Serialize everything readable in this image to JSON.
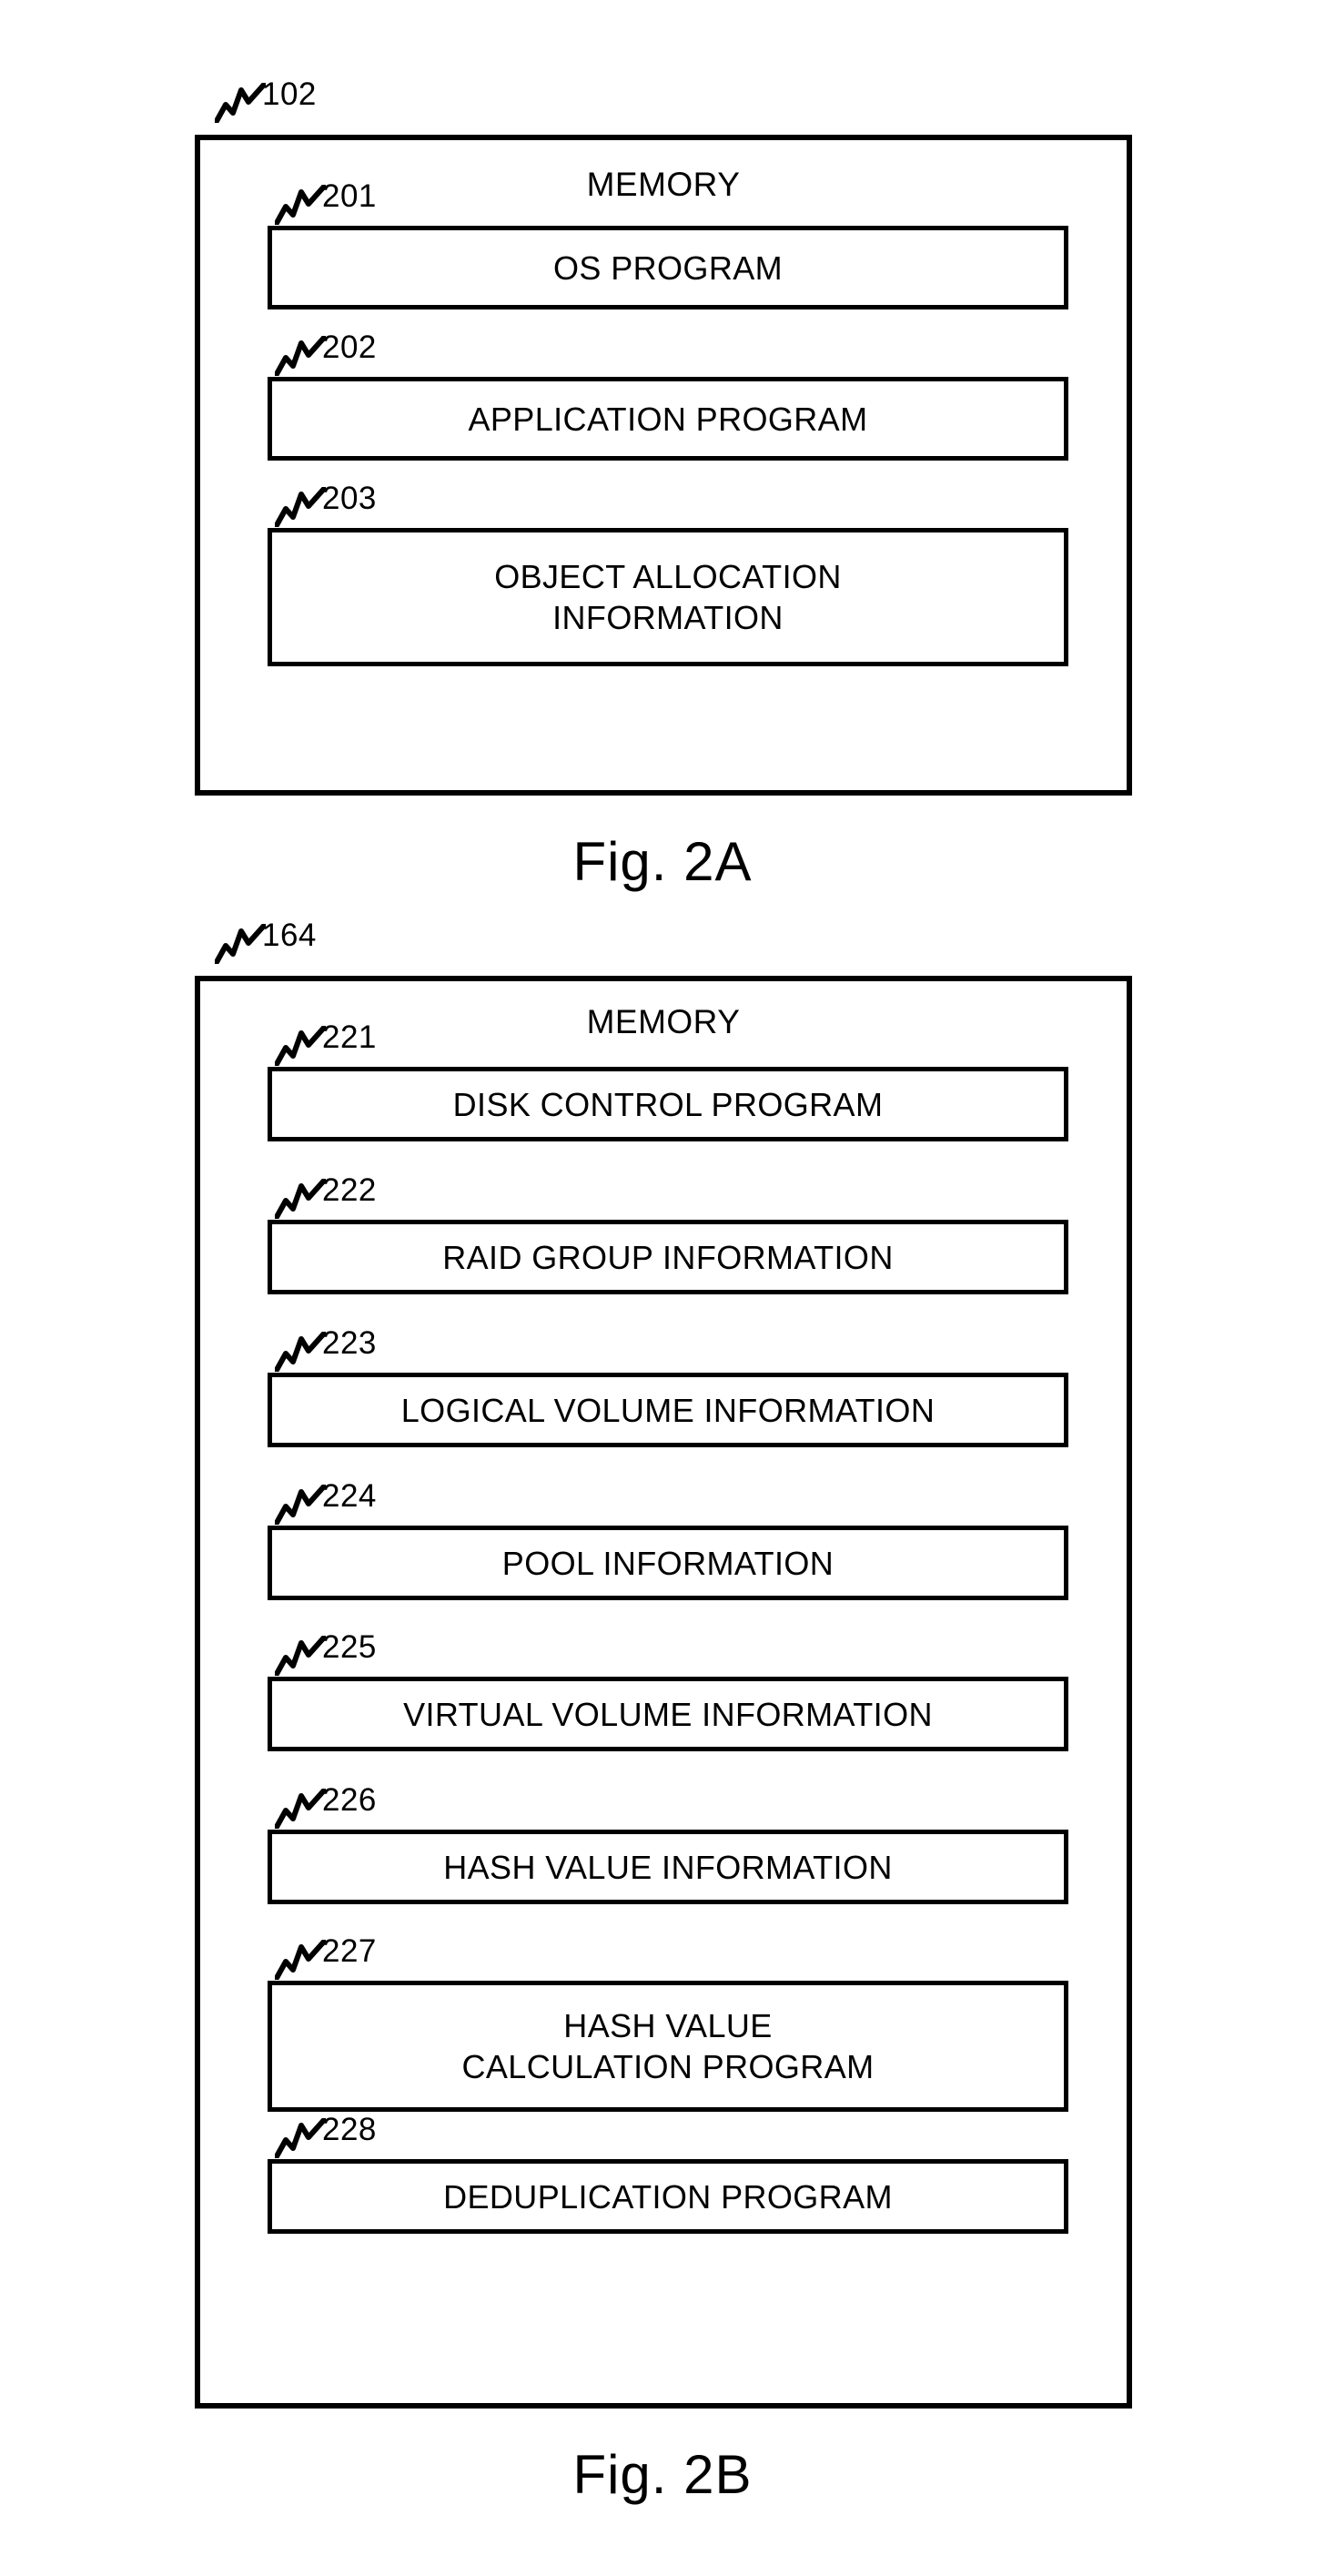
{
  "document": {
    "kind": "patent-drawing-sheet",
    "figures": [
      {
        "id": "2a",
        "caption": "Fig. 2A",
        "outer_ref": "102",
        "title": "MEMORY",
        "boxes": [
          {
            "ref": "201",
            "label": "OS PROGRAM"
          },
          {
            "ref": "202",
            "label": "APPLICATION PROGRAM"
          },
          {
            "ref": "203",
            "label": "OBJECT ALLOCATION\nINFORMATION"
          }
        ]
      },
      {
        "id": "2b",
        "caption": "Fig. 2B",
        "outer_ref": "164",
        "title": "MEMORY",
        "boxes": [
          {
            "ref": "221",
            "label": "DISK CONTROL PROGRAM"
          },
          {
            "ref": "222",
            "label": "RAID GROUP INFORMATION"
          },
          {
            "ref": "223",
            "label": "LOGICAL VOLUME INFORMATION"
          },
          {
            "ref": "224",
            "label": "POOL INFORMATION"
          },
          {
            "ref": "225",
            "label": "VIRTUAL VOLUME INFORMATION"
          },
          {
            "ref": "226",
            "label": "HASH VALUE INFORMATION"
          },
          {
            "ref": "227",
            "label": "HASH VALUE\nCALCULATION PROGRAM"
          },
          {
            "ref": "228",
            "label": "DEDUPLICATION PROGRAM"
          }
        ]
      }
    ],
    "colors": {
      "ink": "#000000",
      "paper": "#ffffff"
    }
  }
}
